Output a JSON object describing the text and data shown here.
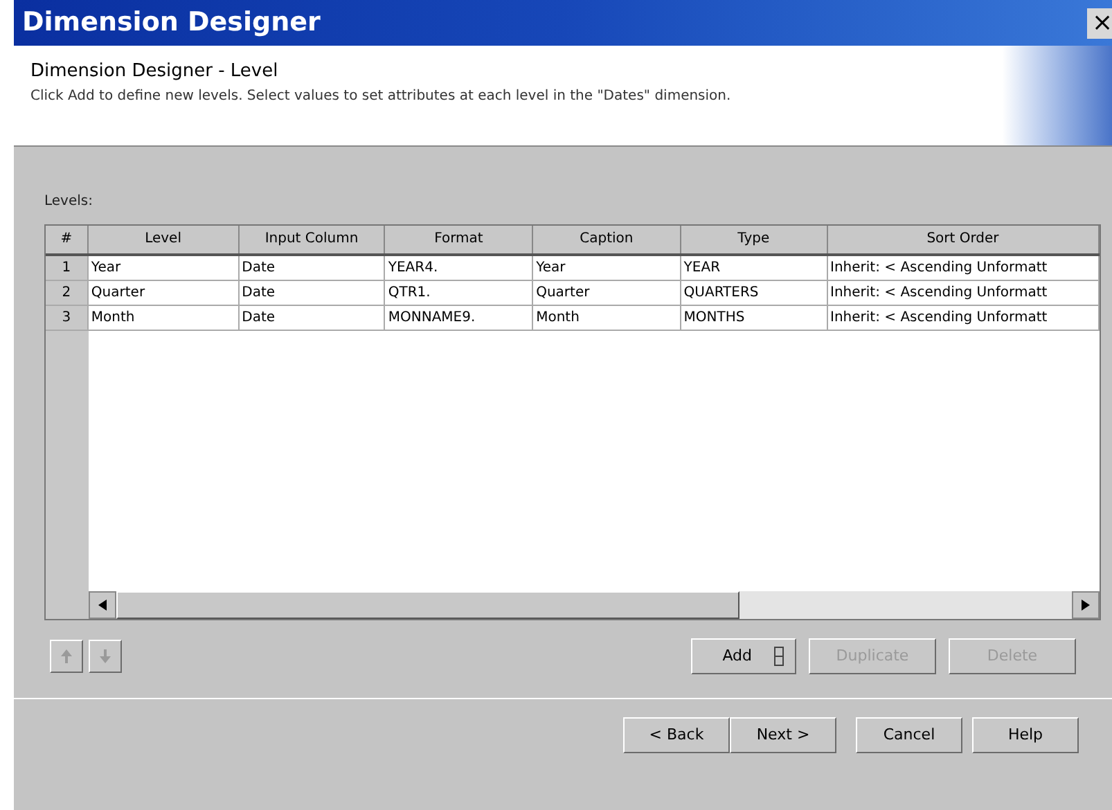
{
  "window": {
    "title": "Dimension Designer",
    "close": "×"
  },
  "header": {
    "title": "Dimension Designer - Level",
    "description": "Click Add to define new levels. Select values to set attributes at each level in the \"Dates\" dimension."
  },
  "levels_label": "Levels:",
  "table": {
    "columns": [
      "#",
      "Level",
      "Input Column",
      "Format",
      "Caption",
      "Type",
      "Sort Order"
    ],
    "rows": [
      {
        "cells": [
          "1",
          "Year",
          "Date",
          "YEAR4.",
          "Year",
          "YEAR",
          "Inherit: < Ascending Unformatt"
        ]
      },
      {
        "cells": [
          "2",
          "Quarter",
          "Date",
          "QTR1.",
          "Quarter",
          "QUARTERS",
          "Inherit: < Ascending Unformatt"
        ]
      },
      {
        "cells": [
          "3",
          "Month",
          "Date",
          "MONNAME9.",
          "Month",
          "MONTHS",
          "Inherit: < Ascending Unformatt"
        ]
      }
    ]
  },
  "move_buttons": [
    {
      "kind": "up",
      "disabled": true
    },
    {
      "kind": "down",
      "disabled": true
    }
  ],
  "row_buttons": [
    {
      "label": "Add",
      "kind": "split",
      "disabled": false
    },
    {
      "label": "Duplicate",
      "kind": "plain",
      "disabled": true
    },
    {
      "label": "Delete",
      "kind": "plain",
      "disabled": true
    }
  ],
  "nav_buttons": [
    {
      "label": "< Back",
      "disabled": false
    },
    {
      "label": "Next >",
      "disabled": false
    },
    {
      "label": "Cancel",
      "disabled": false
    },
    {
      "label": "Help",
      "disabled": false
    }
  ]
}
